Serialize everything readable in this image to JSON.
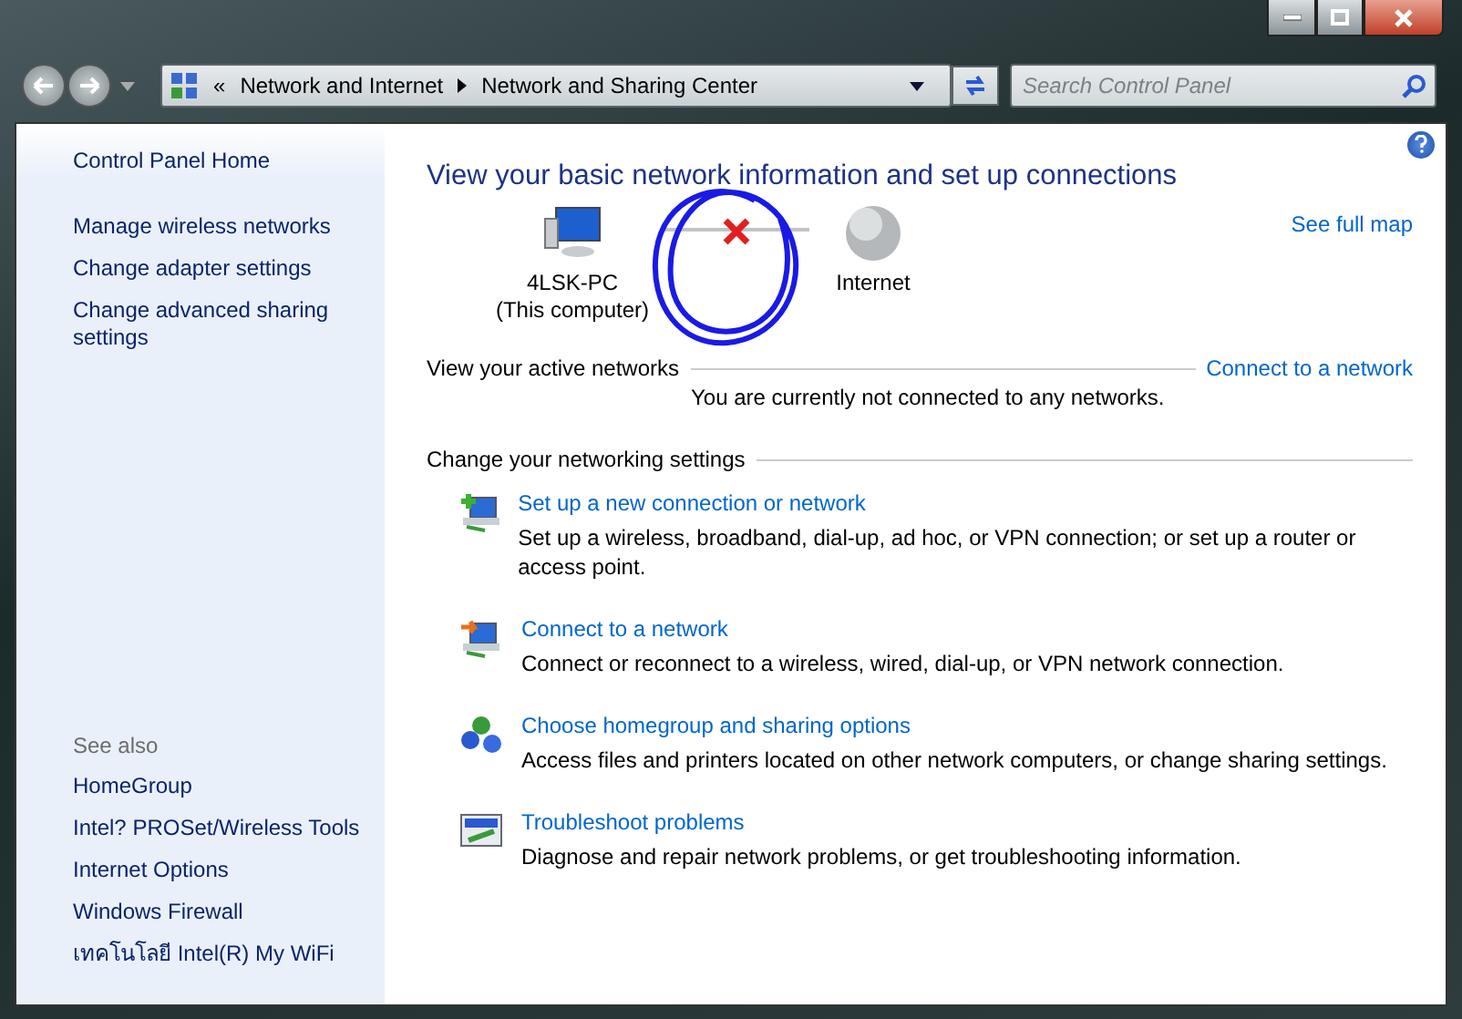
{
  "address": {
    "crumbs": [
      "Network and Internet",
      "Network and Sharing Center"
    ],
    "overflow": "«"
  },
  "search": {
    "placeholder": "Search Control Panel"
  },
  "sidebar": {
    "home": "Control Panel Home",
    "tasks": [
      "Manage wireless networks",
      "Change adapter settings",
      "Change advanced sharing settings"
    ],
    "see_also_heading": "See also",
    "see_also": [
      "HomeGroup",
      "Intel? PROSet/Wireless Tools",
      "Internet Options",
      "Windows Firewall",
      "เทคโนโลยี Intel(R) My WiFi"
    ]
  },
  "main": {
    "title": "View your basic network information and set up connections",
    "see_full_map": "See full map",
    "map": {
      "connected": false,
      "nodes": [
        {
          "kind": "computer",
          "label": "4LSK-PC",
          "sublabel": "(This computer)"
        },
        {
          "kind": "internet",
          "label": "Internet"
        }
      ]
    },
    "active_networks": {
      "heading": "View your active networks",
      "link": "Connect to a network",
      "message": "You are currently not connected to any networks."
    },
    "settings": {
      "heading": "Change your networking settings",
      "items": [
        {
          "kind": "new-connection",
          "link": "Set up a new connection or network",
          "description": "Set up a wireless, broadband, dial-up, ad hoc, or VPN connection; or set up a router or access point."
        },
        {
          "kind": "connect",
          "link": "Connect to a network",
          "description": "Connect or reconnect to a wireless, wired, dial-up, or VPN network connection."
        },
        {
          "kind": "homegroup",
          "link": "Choose homegroup and sharing options",
          "description": "Access files and printers located on other network computers, or change sharing settings."
        },
        {
          "kind": "troubleshoot",
          "link": "Troubleshoot problems",
          "description": "Diagnose and repair network problems, or get troubleshooting information."
        }
      ]
    }
  }
}
